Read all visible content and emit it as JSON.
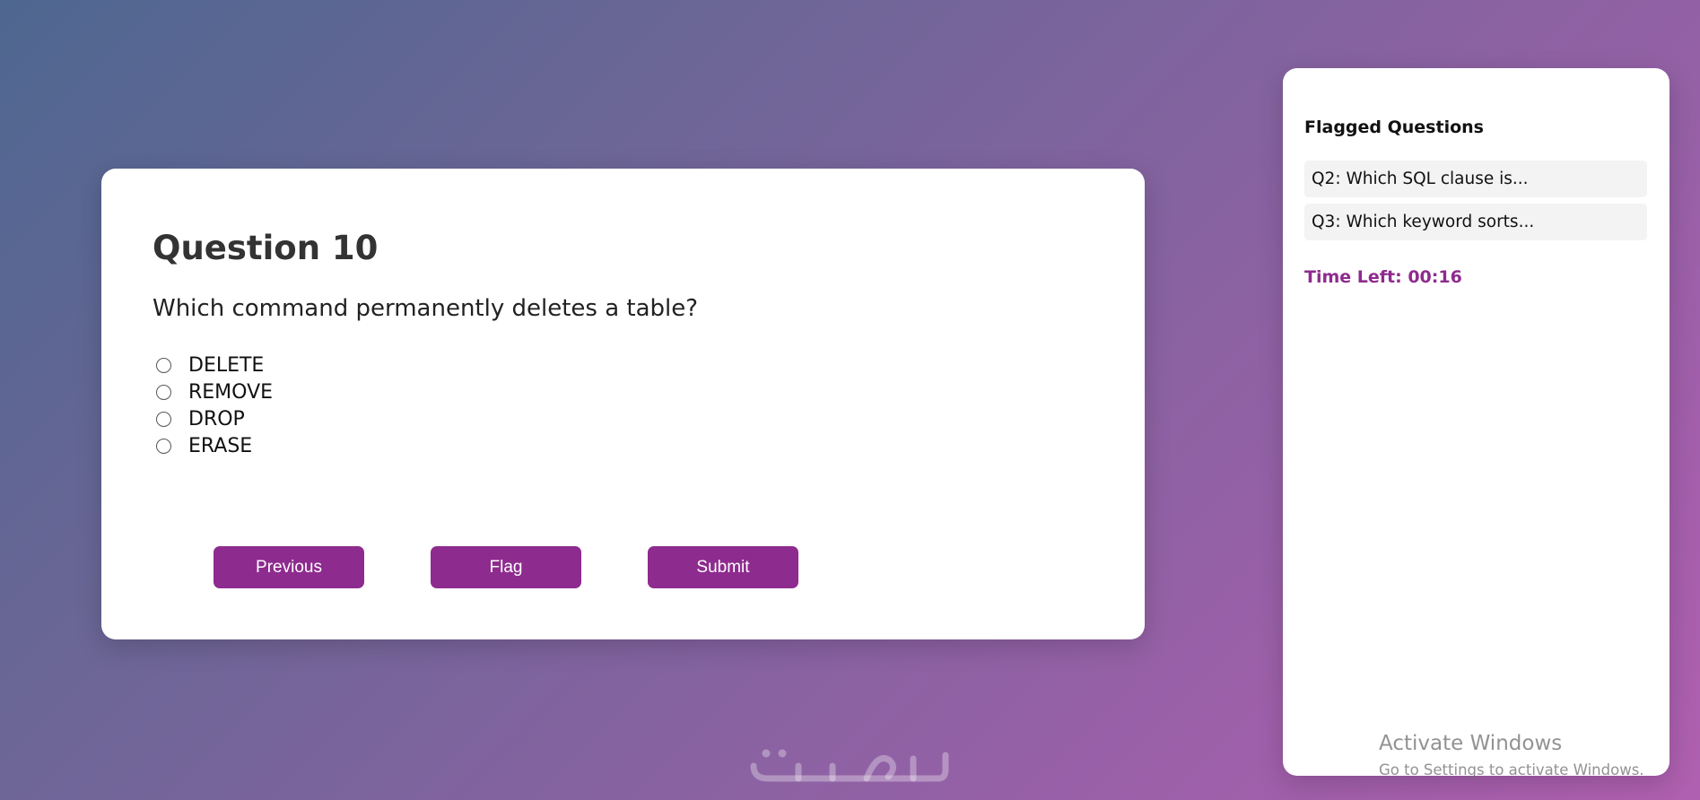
{
  "question": {
    "title": "Question 10",
    "text": "Which command permanently deletes a table?",
    "options": [
      "DELETE",
      "REMOVE",
      "DROP",
      "ERASE"
    ]
  },
  "buttons": {
    "previous": "Previous",
    "flag": "Flag",
    "submit": "Submit"
  },
  "sidebar": {
    "title": "Flagged Questions",
    "flagged": [
      "Q2: Which SQL clause is...",
      "Q3: Which keyword sorts..."
    ],
    "timer": "Time Left: 00:16"
  },
  "watermark": {
    "text": "خمسات"
  },
  "os_overlay": {
    "title": "Activate Windows",
    "subtitle": "Go to Settings to activate Windows."
  },
  "colors": {
    "accent": "#8e2b8e",
    "card": "#ffffff",
    "flag_item_bg": "#f3f3f3"
  }
}
